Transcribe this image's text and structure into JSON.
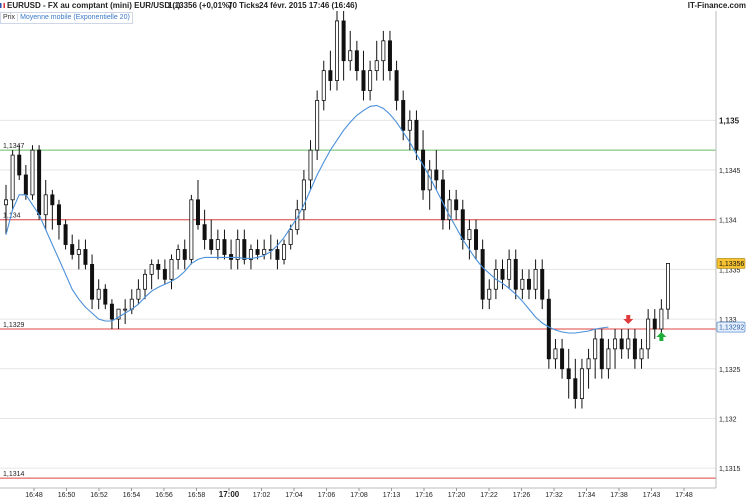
{
  "header": {
    "title": "EURUSD - FX au comptant (mini) EUR/USD (-)",
    "price": "1,13356 (+0,01%)",
    "ticks": "70 Ticks",
    "date": "24 févr. 2015 17:46 (16:46)",
    "brand": "IT-Finance.com"
  },
  "legend": {
    "price_label": "Prix",
    "ema_label": "Moyenne mobile (Exponentielle 20)"
  },
  "colors": {
    "candle": "#111111",
    "ema": "#4a90d9",
    "green_level": "#66bb66",
    "red_level": "#dd4444",
    "last_tag": "#f6c232",
    "arrow_down": "#e03b3b",
    "arrow_up": "#1fae3a"
  },
  "chart_data": {
    "type": "candlestick",
    "ylim": [
      1.1313,
      1.1361
    ],
    "ytick_labels": [
      "1,135",
      "1,1345",
      "1,134",
      "1,1335",
      "1,133",
      "1,1325",
      "1,132",
      "1,1315"
    ],
    "ytick_values": [
      1.135,
      1.1345,
      1.134,
      1.1335,
      1.133,
      1.1325,
      1.132,
      1.1315
    ],
    "ytick_bold": [
      true,
      false,
      false,
      false,
      false,
      false,
      false,
      false
    ],
    "x_labels": [
      "16:48",
      "16:50",
      "16:52",
      "16:54",
      "16:56",
      "16:58",
      "17:00",
      "17:02",
      "17:04",
      "17:06",
      "17:08",
      "17:13",
      "17:16",
      "17:20",
      "17:22",
      "17:26",
      "17:32",
      "17:34",
      "17:38",
      "17:43",
      "17:48"
    ],
    "x_label_bold": [
      false,
      false,
      false,
      false,
      false,
      false,
      true,
      false,
      false,
      false,
      false,
      false,
      false,
      false,
      false,
      false,
      false,
      false,
      false,
      false,
      false
    ],
    "levels": [
      {
        "value": 1.1347,
        "label": "1,1347",
        "color": "#66bb66"
      },
      {
        "value": 1.134,
        "label": "1,134",
        "color": "#dd4444"
      },
      {
        "value": 1.1329,
        "label": "1,1329",
        "color": "#dd4444"
      },
      {
        "value": 1.1314,
        "label": "1,1314",
        "color": "#dd4444"
      }
    ],
    "last_price": {
      "value": 1.13356,
      "label": "1,13356"
    },
    "ema_last": {
      "value": 1.13292,
      "label": "1,13292"
    },
    "candles": [
      {
        "o": 1.13415,
        "h": 1.13435,
        "l": 1.13385,
        "c": 1.1342
      },
      {
        "o": 1.1342,
        "h": 1.1347,
        "l": 1.1341,
        "c": 1.13465
      },
      {
        "o": 1.13465,
        "h": 1.13475,
        "l": 1.1344,
        "c": 1.13445
      },
      {
        "o": 1.13445,
        "h": 1.13455,
        "l": 1.1342,
        "c": 1.13425
      },
      {
        "o": 1.13425,
        "h": 1.13475,
        "l": 1.1342,
        "c": 1.1347
      },
      {
        "o": 1.1347,
        "h": 1.13475,
        "l": 1.134,
        "c": 1.13405
      },
      {
        "o": 1.13405,
        "h": 1.1344,
        "l": 1.1339,
        "c": 1.13425
      },
      {
        "o": 1.13425,
        "h": 1.1343,
        "l": 1.1339,
        "c": 1.13415
      },
      {
        "o": 1.13415,
        "h": 1.1342,
        "l": 1.1338,
        "c": 1.13395
      },
      {
        "o": 1.13395,
        "h": 1.134,
        "l": 1.1337,
        "c": 1.13375
      },
      {
        "o": 1.13375,
        "h": 1.13385,
        "l": 1.1336,
        "c": 1.13365
      },
      {
        "o": 1.13365,
        "h": 1.1338,
        "l": 1.1335,
        "c": 1.1337
      },
      {
        "o": 1.1337,
        "h": 1.1338,
        "l": 1.1335,
        "c": 1.13355
      },
      {
        "o": 1.13355,
        "h": 1.13365,
        "l": 1.1331,
        "c": 1.1332
      },
      {
        "o": 1.1332,
        "h": 1.1334,
        "l": 1.1331,
        "c": 1.1333
      },
      {
        "o": 1.1333,
        "h": 1.13335,
        "l": 1.1331,
        "c": 1.13315
      },
      {
        "o": 1.13315,
        "h": 1.1332,
        "l": 1.1329,
        "c": 1.133
      },
      {
        "o": 1.133,
        "h": 1.1331,
        "l": 1.1329,
        "c": 1.1331
      },
      {
        "o": 1.1331,
        "h": 1.1332,
        "l": 1.13295,
        "c": 1.1331
      },
      {
        "o": 1.1331,
        "h": 1.1333,
        "l": 1.13305,
        "c": 1.1332
      },
      {
        "o": 1.1332,
        "h": 1.1334,
        "l": 1.13315,
        "c": 1.1333
      },
      {
        "o": 1.1333,
        "h": 1.1335,
        "l": 1.1332,
        "c": 1.13345
      },
      {
        "o": 1.13345,
        "h": 1.1336,
        "l": 1.1333,
        "c": 1.13355
      },
      {
        "o": 1.13355,
        "h": 1.1336,
        "l": 1.1334,
        "c": 1.1335
      },
      {
        "o": 1.1335,
        "h": 1.1336,
        "l": 1.13335,
        "c": 1.1334
      },
      {
        "o": 1.1334,
        "h": 1.13365,
        "l": 1.1333,
        "c": 1.1336
      },
      {
        "o": 1.1336,
        "h": 1.13375,
        "l": 1.1335,
        "c": 1.1337
      },
      {
        "o": 1.1337,
        "h": 1.1338,
        "l": 1.1335,
        "c": 1.1336
      },
      {
        "o": 1.1336,
        "h": 1.13425,
        "l": 1.13355,
        "c": 1.1342
      },
      {
        "o": 1.1342,
        "h": 1.1344,
        "l": 1.1339,
        "c": 1.13395
      },
      {
        "o": 1.13395,
        "h": 1.1341,
        "l": 1.1337,
        "c": 1.1338
      },
      {
        "o": 1.1338,
        "h": 1.134,
        "l": 1.13365,
        "c": 1.1337
      },
      {
        "o": 1.1337,
        "h": 1.1339,
        "l": 1.1336,
        "c": 1.1338
      },
      {
        "o": 1.1338,
        "h": 1.1339,
        "l": 1.1336,
        "c": 1.13365
      },
      {
        "o": 1.13365,
        "h": 1.1338,
        "l": 1.1335,
        "c": 1.1336
      },
      {
        "o": 1.1336,
        "h": 1.1339,
        "l": 1.1335,
        "c": 1.1338
      },
      {
        "o": 1.1338,
        "h": 1.1339,
        "l": 1.13355,
        "c": 1.1336
      },
      {
        "o": 1.1336,
        "h": 1.13375,
        "l": 1.1335,
        "c": 1.1337
      },
      {
        "o": 1.1337,
        "h": 1.1338,
        "l": 1.1336,
        "c": 1.13365
      },
      {
        "o": 1.13365,
        "h": 1.1338,
        "l": 1.1336,
        "c": 1.1337
      },
      {
        "o": 1.1337,
        "h": 1.13385,
        "l": 1.1336,
        "c": 1.1337
      },
      {
        "o": 1.1337,
        "h": 1.1338,
        "l": 1.1335,
        "c": 1.1336
      },
      {
        "o": 1.1336,
        "h": 1.1338,
        "l": 1.13355,
        "c": 1.13375
      },
      {
        "o": 1.13375,
        "h": 1.13395,
        "l": 1.1337,
        "c": 1.1339
      },
      {
        "o": 1.1339,
        "h": 1.1342,
        "l": 1.13385,
        "c": 1.1341
      },
      {
        "o": 1.1341,
        "h": 1.1345,
        "l": 1.134,
        "c": 1.1344
      },
      {
        "o": 1.1344,
        "h": 1.1348,
        "l": 1.1343,
        "c": 1.1347
      },
      {
        "o": 1.1347,
        "h": 1.1353,
        "l": 1.1346,
        "c": 1.1352
      },
      {
        "o": 1.1352,
        "h": 1.1356,
        "l": 1.1351,
        "c": 1.1355
      },
      {
        "o": 1.1355,
        "h": 1.1357,
        "l": 1.1353,
        "c": 1.1354
      },
      {
        "o": 1.1354,
        "h": 1.1361,
        "l": 1.1353,
        "c": 1.136
      },
      {
        "o": 1.136,
        "h": 1.1361,
        "l": 1.1354,
        "c": 1.1356
      },
      {
        "o": 1.1356,
        "h": 1.1359,
        "l": 1.1355,
        "c": 1.1357
      },
      {
        "o": 1.1357,
        "h": 1.1358,
        "l": 1.1354,
        "c": 1.1355
      },
      {
        "o": 1.1355,
        "h": 1.1357,
        "l": 1.1352,
        "c": 1.1353
      },
      {
        "o": 1.1353,
        "h": 1.1356,
        "l": 1.1352,
        "c": 1.1355
      },
      {
        "o": 1.1355,
        "h": 1.1358,
        "l": 1.1354,
        "c": 1.1356
      },
      {
        "o": 1.1356,
        "h": 1.1359,
        "l": 1.1354,
        "c": 1.1358
      },
      {
        "o": 1.1358,
        "h": 1.1359,
        "l": 1.1354,
        "c": 1.1355
      },
      {
        "o": 1.1355,
        "h": 1.1356,
        "l": 1.1351,
        "c": 1.1352
      },
      {
        "o": 1.1352,
        "h": 1.1353,
        "l": 1.1348,
        "c": 1.1349
      },
      {
        "o": 1.1349,
        "h": 1.1351,
        "l": 1.1347,
        "c": 1.135
      },
      {
        "o": 1.135,
        "h": 1.1351,
        "l": 1.1346,
        "c": 1.1347
      },
      {
        "o": 1.1347,
        "h": 1.1349,
        "l": 1.1342,
        "c": 1.1343
      },
      {
        "o": 1.1343,
        "h": 1.1346,
        "l": 1.1341,
        "c": 1.1345
      },
      {
        "o": 1.1345,
        "h": 1.1347,
        "l": 1.1343,
        "c": 1.1344
      },
      {
        "o": 1.1344,
        "h": 1.1345,
        "l": 1.1339,
        "c": 1.134
      },
      {
        "o": 1.134,
        "h": 1.1343,
        "l": 1.1339,
        "c": 1.1342
      },
      {
        "o": 1.1342,
        "h": 1.1343,
        "l": 1.134,
        "c": 1.1341
      },
      {
        "o": 1.1341,
        "h": 1.1342,
        "l": 1.1337,
        "c": 1.1338
      },
      {
        "o": 1.1338,
        "h": 1.134,
        "l": 1.1336,
        "c": 1.1339
      },
      {
        "o": 1.1339,
        "h": 1.134,
        "l": 1.1336,
        "c": 1.1337
      },
      {
        "o": 1.1337,
        "h": 1.1338,
        "l": 1.1331,
        "c": 1.1332
      },
      {
        "o": 1.1332,
        "h": 1.1334,
        "l": 1.1331,
        "c": 1.1333
      },
      {
        "o": 1.1333,
        "h": 1.1336,
        "l": 1.1332,
        "c": 1.1335
      },
      {
        "o": 1.1335,
        "h": 1.1336,
        "l": 1.1333,
        "c": 1.1334
      },
      {
        "o": 1.1334,
        "h": 1.1337,
        "l": 1.1333,
        "c": 1.1336
      },
      {
        "o": 1.1336,
        "h": 1.1337,
        "l": 1.1332,
        "c": 1.1333
      },
      {
        "o": 1.1333,
        "h": 1.1335,
        "l": 1.1332,
        "c": 1.1334
      },
      {
        "o": 1.1334,
        "h": 1.1335,
        "l": 1.1332,
        "c": 1.1333
      },
      {
        "o": 1.1333,
        "h": 1.1336,
        "l": 1.1332,
        "c": 1.1335
      },
      {
        "o": 1.1335,
        "h": 1.1336,
        "l": 1.1331,
        "c": 1.1332
      },
      {
        "o": 1.1332,
        "h": 1.1333,
        "l": 1.1325,
        "c": 1.1326
      },
      {
        "o": 1.1326,
        "h": 1.1328,
        "l": 1.1325,
        "c": 1.1327
      },
      {
        "o": 1.1327,
        "h": 1.1328,
        "l": 1.1324,
        "c": 1.1325
      },
      {
        "o": 1.1325,
        "h": 1.1327,
        "l": 1.1322,
        "c": 1.1324
      },
      {
        "o": 1.1324,
        "h": 1.1326,
        "l": 1.1321,
        "c": 1.1322
      },
      {
        "o": 1.1322,
        "h": 1.1326,
        "l": 1.1321,
        "c": 1.1325
      },
      {
        "o": 1.1325,
        "h": 1.1327,
        "l": 1.1323,
        "c": 1.1326
      },
      {
        "o": 1.1326,
        "h": 1.1329,
        "l": 1.1324,
        "c": 1.1328
      },
      {
        "o": 1.1328,
        "h": 1.1329,
        "l": 1.1324,
        "c": 1.1325
      },
      {
        "o": 1.1325,
        "h": 1.1328,
        "l": 1.1324,
        "c": 1.1327
      },
      {
        "o": 1.1327,
        "h": 1.1329,
        "l": 1.1325,
        "c": 1.1328
      },
      {
        "o": 1.1328,
        "h": 1.1329,
        "l": 1.1326,
        "c": 1.1327
      },
      {
        "o": 1.1327,
        "h": 1.1329,
        "l": 1.1326,
        "c": 1.1328
      },
      {
        "o": 1.1328,
        "h": 1.1329,
        "l": 1.1325,
        "c": 1.1326
      },
      {
        "o": 1.1326,
        "h": 1.1328,
        "l": 1.1325,
        "c": 1.1327
      },
      {
        "o": 1.1327,
        "h": 1.1331,
        "l": 1.1326,
        "c": 1.133
      },
      {
        "o": 1.133,
        "h": 1.1331,
        "l": 1.1328,
        "c": 1.1329
      },
      {
        "o": 1.1329,
        "h": 1.1332,
        "l": 1.1328,
        "c": 1.1331
      },
      {
        "o": 1.1331,
        "h": 1.13356,
        "l": 1.133,
        "c": 1.13356
      }
    ],
    "ema": [
      1.13385,
      1.1341,
      1.13425,
      1.13425,
      1.13415,
      1.13405,
      1.1339,
      1.13375,
      1.1336,
      1.13345,
      1.1333,
      1.1332,
      1.13312,
      1.13306,
      1.133,
      1.13298,
      1.13298,
      1.13302,
      1.13306,
      1.1331,
      1.13315,
      1.13322,
      1.13328,
      1.13332,
      1.13335,
      1.13338,
      1.13342,
      1.13348,
      1.13356,
      1.1336,
      1.13362,
      1.13362,
      1.13362,
      1.13362,
      1.13362,
      1.13362,
      1.13361,
      1.13361,
      1.13362,
      1.13364,
      1.13368,
      1.13374,
      1.13382,
      1.13392,
      1.13402,
      1.13415,
      1.1343,
      1.13445,
      1.13458,
      1.1347,
      1.1348,
      1.1349,
      1.13498,
      1.13505,
      1.1351,
      1.13514,
      1.13515,
      1.13512,
      1.13506,
      1.13498,
      1.13488,
      1.13478,
      1.13466,
      1.13455,
      1.13443,
      1.1343,
      1.13417,
      1.13404,
      1.13392,
      1.1338,
      1.1337,
      1.1336,
      1.13352,
      1.13346,
      1.1334,
      1.13336,
      1.13331,
      1.13325,
      1.13318,
      1.1331,
      1.13302,
      1.13296,
      1.13292,
      1.13289,
      1.13287,
      1.13286,
      1.13286,
      1.13287,
      1.13288,
      1.1329,
      1.13291,
      1.13292
    ]
  }
}
